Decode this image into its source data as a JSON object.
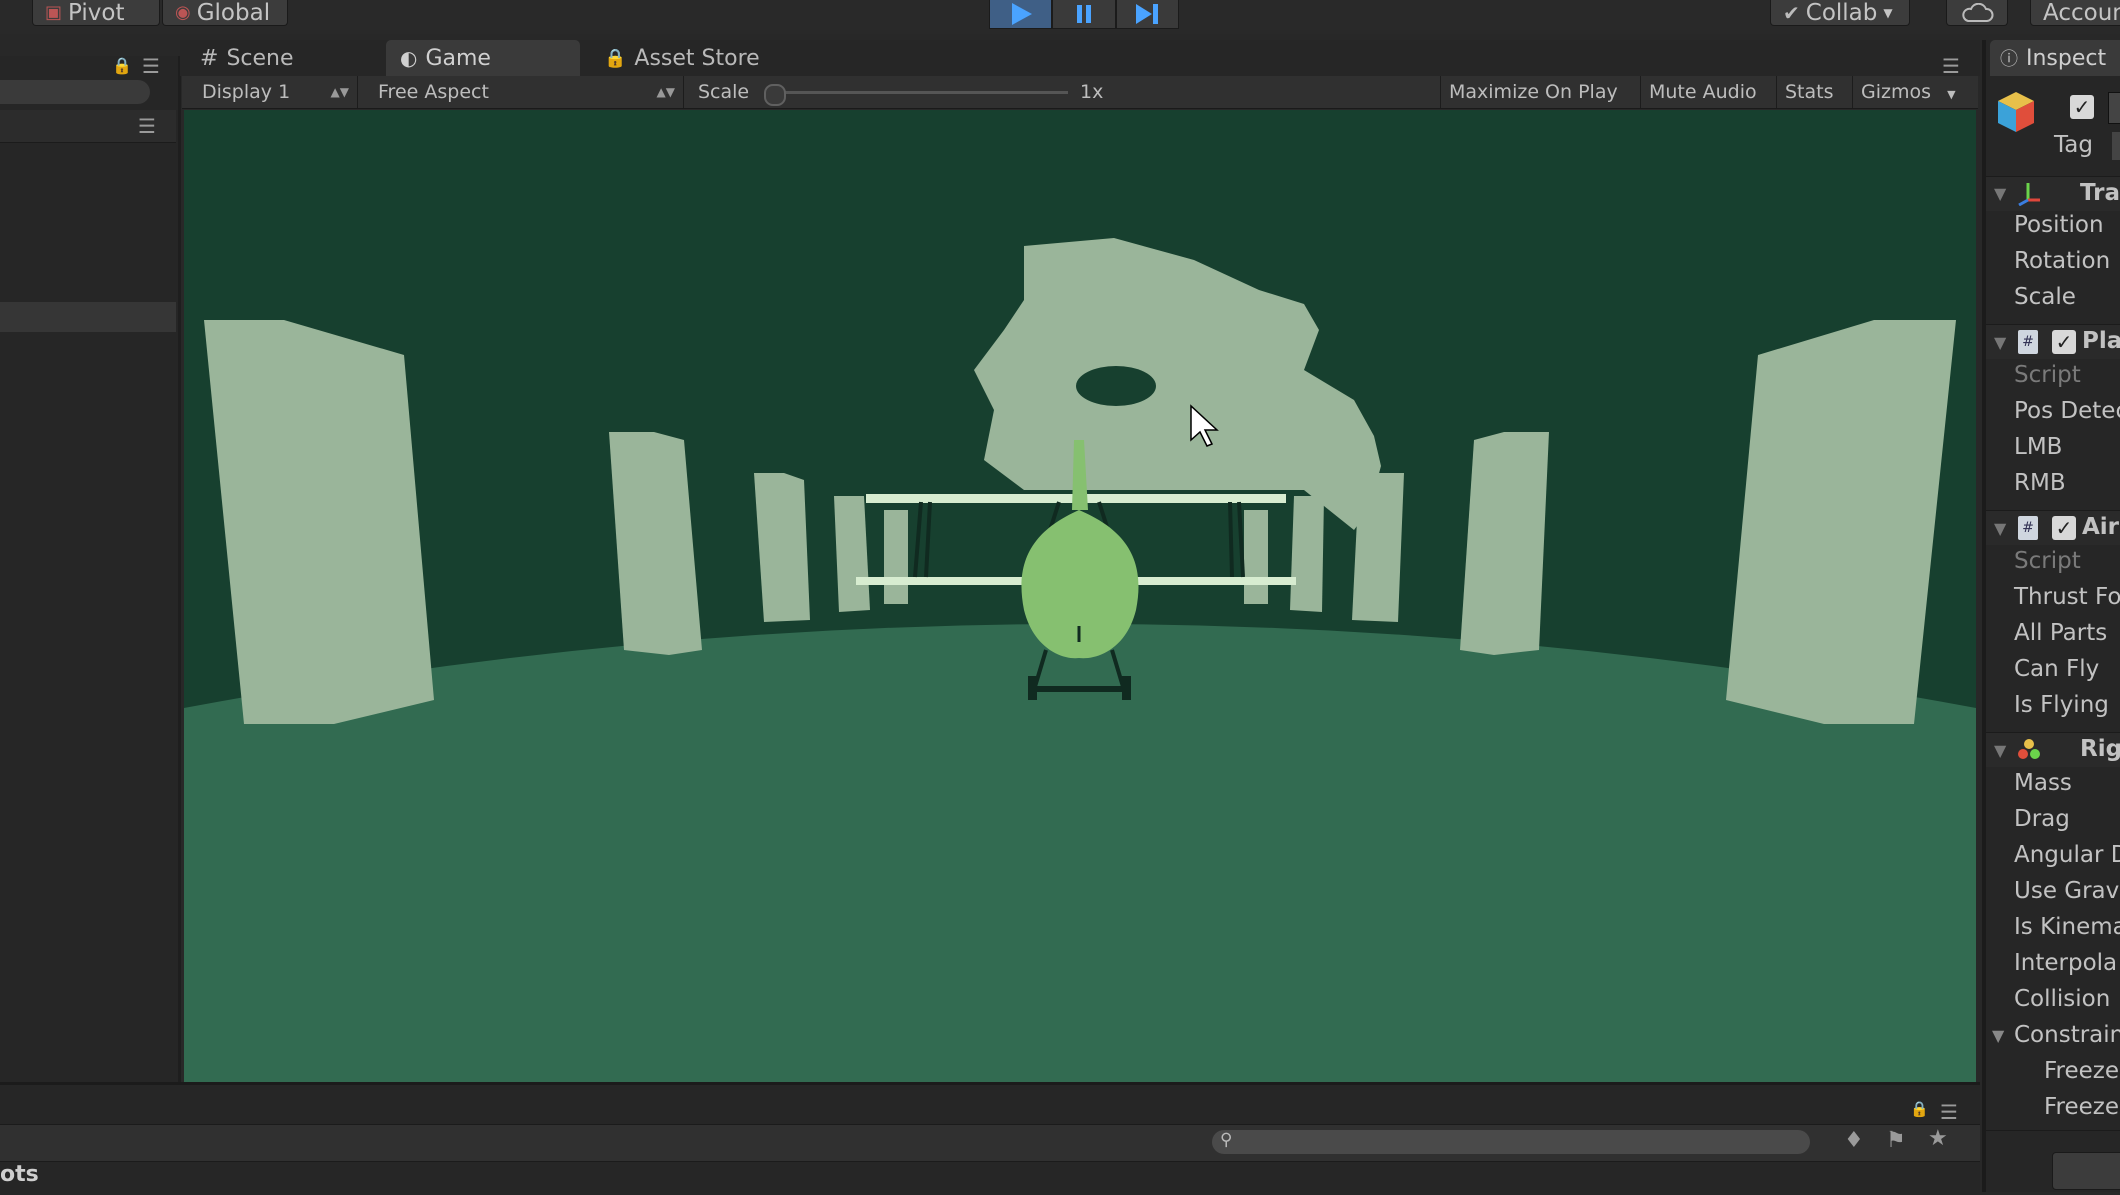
{
  "toolbar": {
    "pivot_label": "Pivot",
    "global_label": "Global",
    "collab_label": "Collab",
    "account_label": "Accoun"
  },
  "tabs": {
    "scene": "Scene",
    "game": "Game",
    "asset_store": "Asset Store",
    "inspector": "Inspect"
  },
  "game_toolbar": {
    "display": "Display 1",
    "aspect": "Free Aspect",
    "scale_label": "Scale",
    "scale_value": "1x",
    "maximize": "Maximize On Play",
    "mute": "Mute Audio",
    "stats": "Stats",
    "gizmos": "Gizmos"
  },
  "inspector": {
    "tag_label": "Tag",
    "transform": {
      "header": "Tra",
      "fields": [
        "Position",
        "Rotation",
        "Scale"
      ]
    },
    "player_script": {
      "header": "Pla",
      "fields": [
        "Script",
        "Pos Detec",
        "LMB",
        "RMB"
      ]
    },
    "aircraft_script": {
      "header": "Air",
      "fields": [
        "Script",
        "Thrust Fo",
        "All Parts",
        "Can Fly",
        "Is Flying"
      ]
    },
    "rigidbody": {
      "header": "Rig",
      "fields": [
        "Mass",
        "Drag",
        "Angular D",
        "Use Grav",
        "Is Kinema",
        "Interpola",
        "Collision"
      ],
      "constraints_label": "Constrain",
      "constraint_rows": [
        "Freeze",
        "Freeze"
      ]
    }
  },
  "bottom_panel": {
    "label": "ots"
  },
  "colors": {
    "sky": "#17402f",
    "ground": "#326b51",
    "rock": "#9ab59a",
    "plane_body": "#86c070",
    "play_accent": "#3f5f86"
  }
}
